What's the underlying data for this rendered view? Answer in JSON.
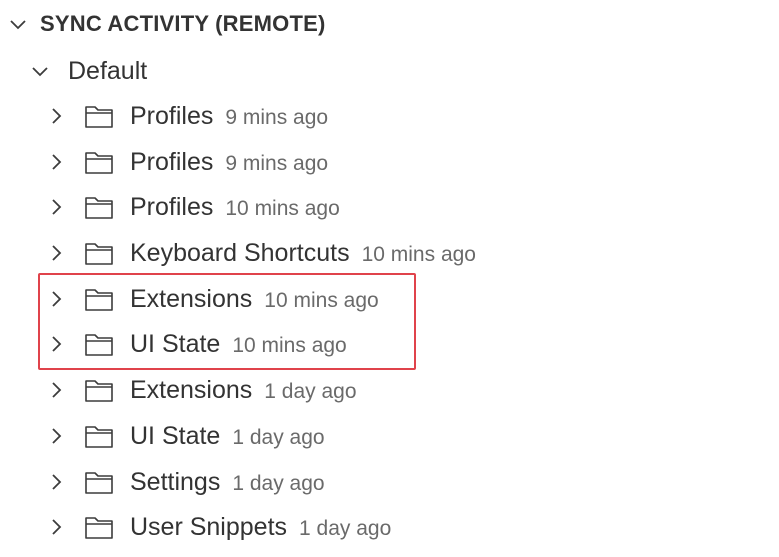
{
  "section": {
    "title": "SYNC ACTIVITY (REMOTE)",
    "expanded": true,
    "icon": "chevron-down-icon"
  },
  "group": {
    "label": "Default",
    "expanded": true,
    "icon": "chevron-down-icon"
  },
  "items": [
    {
      "name": "Profiles",
      "time": "9 mins ago"
    },
    {
      "name": "Profiles",
      "time": "9 mins ago"
    },
    {
      "name": "Profiles",
      "time": "10 mins ago"
    },
    {
      "name": "Keyboard Shortcuts",
      "time": "10 mins ago"
    },
    {
      "name": "Extensions",
      "time": "10 mins ago"
    },
    {
      "name": "UI State",
      "time": "10 mins ago"
    },
    {
      "name": "Extensions",
      "time": "1 day ago"
    },
    {
      "name": "UI State",
      "time": "1 day ago"
    },
    {
      "name": "Settings",
      "time": "1 day ago"
    },
    {
      "name": "User Snippets",
      "time": "1 day ago"
    }
  ],
  "highlight": {
    "color": "#e0434b",
    "item_indices": [
      4,
      5
    ]
  },
  "item_icons": {
    "expander": "chevron-right-icon",
    "folder": "folder-icon"
  }
}
